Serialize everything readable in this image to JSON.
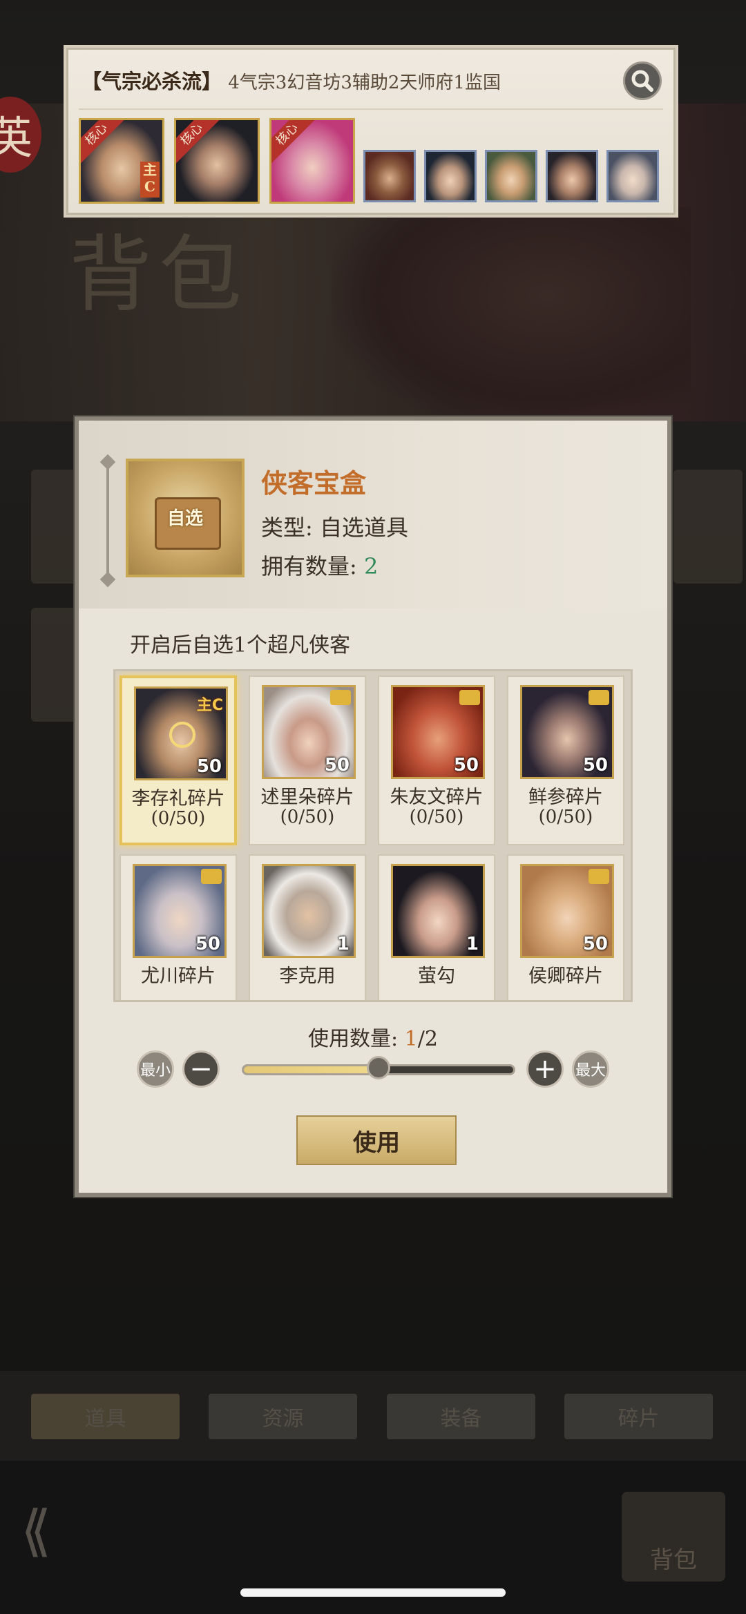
{
  "lineup": {
    "tag": "【气宗必杀流】",
    "description": "4气宗3幻音坊3辅助2天师府1监国",
    "core_label": "核心",
    "main_label": "主C"
  },
  "item": {
    "name": "侠客宝盒",
    "type_label": "类型:",
    "type_value": "自选道具",
    "own_label": "拥有数量:",
    "own_count": "2",
    "icon_text": "自选"
  },
  "hint": "开启后自选1个超凡侠客",
  "heroes": [
    {
      "name": "李存礼碎片",
      "progress": "(0/50)",
      "count": "50",
      "selected": true,
      "badge": "主C"
    },
    {
      "name": "述里朵碎片",
      "progress": "(0/50)",
      "count": "50"
    },
    {
      "name": "朱友文碎片",
      "progress": "(0/50)",
      "count": "50"
    },
    {
      "name": "鲜参碎片",
      "progress": "(0/50)",
      "count": "50"
    },
    {
      "name": "尤川碎片",
      "progress": "",
      "count": "50"
    },
    {
      "name": "李克用",
      "progress": "",
      "count": "1"
    },
    {
      "name": "萤勾",
      "progress": "",
      "count": "1"
    },
    {
      "name": "侯卿碎片",
      "progress": "",
      "count": "50"
    }
  ],
  "quantity": {
    "label": "使用数量:",
    "current": "1",
    "total": "/2",
    "fraction": 0.5,
    "min_label": "最小",
    "max_label": "最大",
    "minus": "−",
    "plus": "+"
  },
  "use_button": "使用",
  "background": {
    "bag_title": "背包",
    "seal": "英",
    "tabs": [
      "道具",
      "资源",
      "装备",
      "碎片"
    ],
    "bag_button": "背包"
  },
  "colors": {
    "accent": "#c26e2a",
    "count_green": "#2f8a5a",
    "gold_border": "#c7a24e"
  }
}
